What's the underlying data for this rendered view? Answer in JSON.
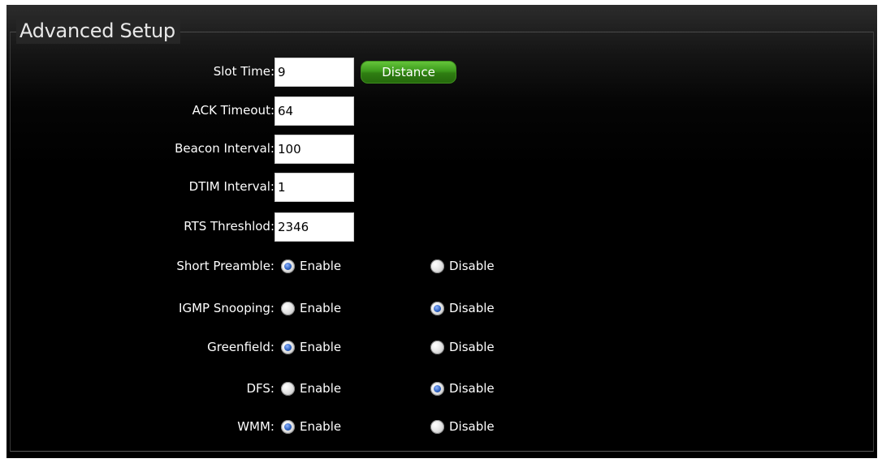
{
  "section": {
    "title": "Advanced Setup"
  },
  "fields": {
    "slot_time": {
      "label": "Slot Time:",
      "value": "9"
    },
    "distance_button": {
      "label": "Distance"
    },
    "ack_timeout": {
      "label": "ACK Timeout:",
      "value": "64"
    },
    "beacon_interval": {
      "label": "Beacon Interval:",
      "value": "100"
    },
    "dtim_interval": {
      "label": "DTIM Interval:",
      "value": "1"
    },
    "rts_threshold": {
      "label": "RTS Threshlod:",
      "value": "2346"
    }
  },
  "options": {
    "enable_label": "Enable",
    "disable_label": "Disable",
    "short_preamble": {
      "label": "Short Preamble:",
      "selected": "Enable"
    },
    "igmp_snooping": {
      "label": "IGMP Snooping:",
      "selected": "Disable"
    },
    "greenfield": {
      "label": "Greenfield:",
      "selected": "Enable"
    },
    "dfs": {
      "label": "DFS:",
      "selected": "Disable"
    },
    "wmm": {
      "label": "WMM:",
      "selected": "Enable"
    }
  },
  "colors": {
    "panel_background": "#000000",
    "button_green": "#3c9a1c",
    "radio_selected_blue": "#2b5fbd"
  }
}
